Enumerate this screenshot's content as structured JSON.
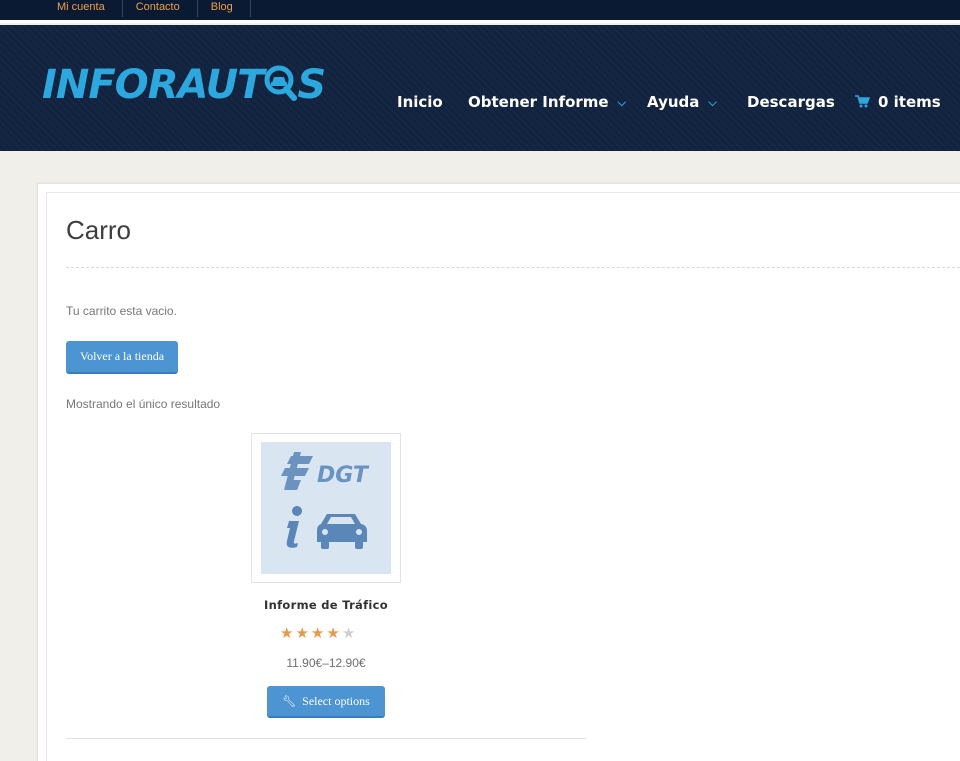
{
  "topbar": {
    "links": [
      {
        "label": "Mi cuenta"
      },
      {
        "label": "Contacto"
      },
      {
        "label": "Blog"
      }
    ]
  },
  "header": {
    "logo": {
      "part1": "INFORAUT",
      "part2": "S",
      "accent_color": "#2da8df"
    },
    "nav": [
      {
        "label": "Inicio",
        "has_dropdown": false
      },
      {
        "label": "Obtener Informe",
        "has_dropdown": true
      },
      {
        "label": "Ayuda",
        "has_dropdown": true
      },
      {
        "label": "Descargas",
        "has_dropdown": false
      }
    ],
    "cart": {
      "label": "0 items",
      "icon": "cart-icon"
    }
  },
  "main": {
    "title": "Carro",
    "empty_message": "Tu carrito esta vacio.",
    "back_button": "Volver a la tienda",
    "result_count": "Mostrando el único resultado",
    "product": {
      "image_text": "DGT",
      "name": "Informe de Tráfico",
      "rating": 4,
      "rating_max": 5,
      "price": "11.90€–12.90€",
      "button": "Select options"
    }
  },
  "colors": {
    "header_bg": "#11233f",
    "topbar_bg": "#0a1a33",
    "topbar_link": "#e9a04d",
    "button_blue": "#4c94d2",
    "star": "#e79a4c"
  }
}
